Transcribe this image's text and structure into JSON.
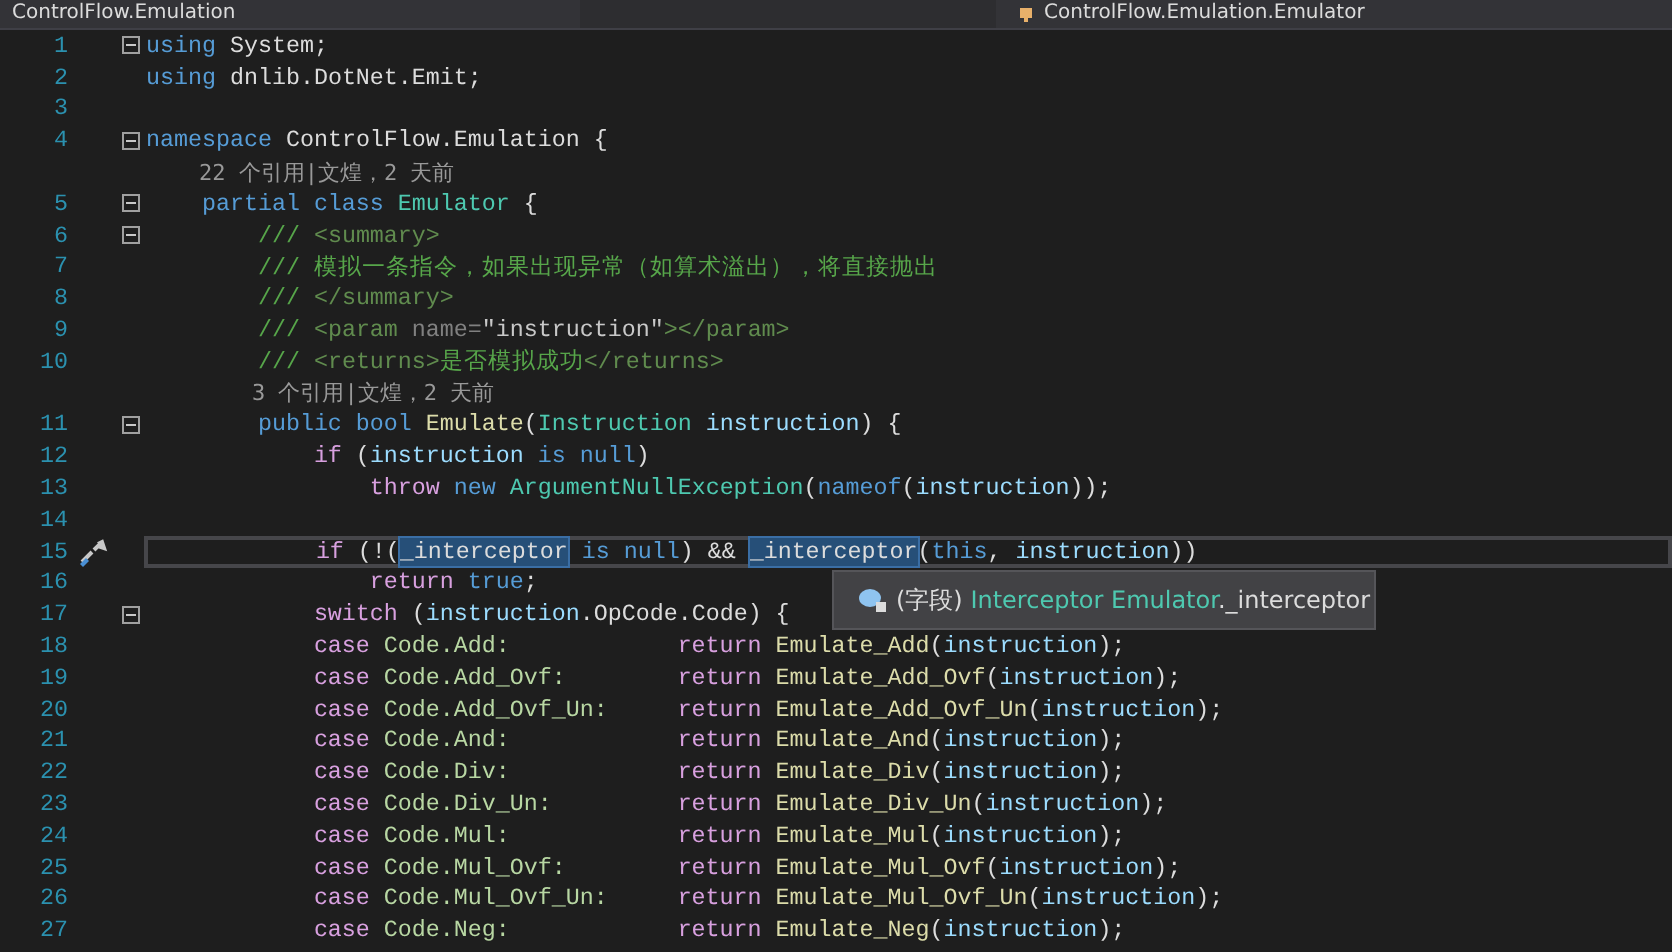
{
  "navigation_bar": {
    "project": "ControlFlow.Emulation",
    "member": "ControlFlow.Emulation.Emulator"
  },
  "lines": [
    {
      "number": "1",
      "fold": true,
      "tokens": [
        {
          "kind": "keyword",
          "text": "using"
        },
        {
          "kind": "plain",
          "text": " System;"
        }
      ]
    },
    {
      "number": "2",
      "tokens": [
        {
          "kind": "keyword",
          "text": "using"
        },
        {
          "kind": "plain",
          "text": " dnlib.DotNet.Emit;"
        }
      ]
    },
    {
      "number": "3"
    },
    {
      "number": "4",
      "fold": true,
      "tokens": [
        {
          "kind": "keyword",
          "text": "namespace"
        },
        {
          "kind": "plain",
          "text": " ControlFlow.Emulation {"
        }
      ]
    },
    {
      "tokens": [
        {
          "kind": "lens",
          "text": "    22 个引用|文煌，2 天前"
        }
      ]
    },
    {
      "number": "5",
      "fold": true,
      "tokens": [
        {
          "kind": "keyword",
          "text": "    partial class "
        },
        {
          "kind": "type",
          "text": "Emulator"
        },
        {
          "kind": "plain",
          "text": " {"
        }
      ]
    },
    {
      "number": "6",
      "fold": true,
      "tokens": [
        {
          "kind": "comment",
          "text": "        /// "
        },
        {
          "kind": "doctag",
          "text": "<summary>"
        }
      ]
    },
    {
      "number": "7",
      "tokens": [
        {
          "kind": "comment",
          "text": "        /// 模拟一条指令，如果出现异常（如算术溢出），将直接抛出"
        }
      ]
    },
    {
      "number": "8",
      "tokens": [
        {
          "kind": "comment",
          "text": "        /// "
        },
        {
          "kind": "doctag",
          "text": "</summary>"
        }
      ]
    },
    {
      "number": "9",
      "tokens": [
        {
          "kind": "comment",
          "text": "        /// "
        },
        {
          "kind": "doctag",
          "text": "<param "
        },
        {
          "kind": "docattr",
          "text": "name="
        },
        {
          "kind": "docvalue",
          "text": "\"instruction\""
        },
        {
          "kind": "doctag",
          "text": "></param>"
        }
      ]
    },
    {
      "number": "10",
      "tokens": [
        {
          "kind": "comment",
          "text": "        /// "
        },
        {
          "kind": "doctag",
          "text": "<returns>"
        },
        {
          "kind": "comment",
          "text": "是否模拟成功"
        },
        {
          "kind": "doctag",
          "text": "</returns>"
        }
      ]
    },
    {
      "tokens": [
        {
          "kind": "lens",
          "text": "        3 个引用|文煌，2 天前"
        }
      ]
    },
    {
      "number": "11",
      "fold": true,
      "tokens": [
        {
          "kind": "keyword",
          "text": "        public bool "
        },
        {
          "kind": "method",
          "text": "Emulate"
        },
        {
          "kind": "plain",
          "text": "("
        },
        {
          "kind": "type",
          "text": "Instruction "
        },
        {
          "kind": "variable",
          "text": "instruction"
        },
        {
          "kind": "plain",
          "text": ") {"
        }
      ]
    },
    {
      "number": "12",
      "tokens": [
        {
          "kind": "control",
          "text": "            if"
        },
        {
          "kind": "plain",
          "text": " ("
        },
        {
          "kind": "variable",
          "text": "instruction"
        },
        {
          "kind": "keyword",
          "text": " is null"
        },
        {
          "kind": "plain",
          "text": ")"
        }
      ]
    },
    {
      "number": "13",
      "tokens": [
        {
          "kind": "control",
          "text": "                throw"
        },
        {
          "kind": "keyword",
          "text": " new "
        },
        {
          "kind": "type",
          "text": "ArgumentNullException"
        },
        {
          "kind": "plain",
          "text": "("
        },
        {
          "kind": "keyword",
          "text": "nameof"
        },
        {
          "kind": "plain",
          "text": "("
        },
        {
          "kind": "variable",
          "text": "instruction"
        },
        {
          "kind": "plain",
          "text": "));"
        }
      ]
    },
    {
      "number": "14"
    },
    {
      "number": "15",
      "current": true,
      "quick_actions": true,
      "tokens": [
        {
          "kind": "control",
          "text": "            if",
          "highlighted": false
        },
        {
          "kind": "plain",
          "text": " (!(",
          "highlighted": false
        },
        {
          "kind": "field",
          "text": "_interceptor",
          "highlighted": true
        },
        {
          "kind": "keyword",
          "text": " is null",
          "highlighted": false
        },
        {
          "kind": "plain",
          "text": ") && ",
          "highlighted": false
        },
        {
          "kind": "field",
          "text": "_interceptor",
          "highlighted": true
        },
        {
          "kind": "plain",
          "text": "(",
          "highlighted": false
        },
        {
          "kind": "keyword",
          "text": "this",
          "highlighted": false
        },
        {
          "kind": "plain",
          "text": ", ",
          "highlighted": false
        },
        {
          "kind": "variable",
          "text": "instruction",
          "highlighted": false
        },
        {
          "kind": "plain",
          "text": "))",
          "highlighted": false
        }
      ]
    },
    {
      "number": "16",
      "tokens": [
        {
          "kind": "control",
          "text": "                return"
        },
        {
          "kind": "keyword",
          "text": " true"
        },
        {
          "kind": "plain",
          "text": ";"
        }
      ]
    },
    {
      "number": "17",
      "fold": true,
      "tokens": [
        {
          "kind": "control",
          "text": "            switch"
        },
        {
          "kind": "plain",
          "text": " ("
        },
        {
          "kind": "variable",
          "text": "instruction"
        },
        {
          "kind": "plain",
          "text": ".OpCode.Code) {"
        }
      ]
    },
    {
      "number": "18",
      "tokens": [
        {
          "kind": "control",
          "text": "            case"
        },
        {
          "kind": "enum",
          "text": " Code.Add:            "
        },
        {
          "kind": "control",
          "text": "return "
        },
        {
          "kind": "method",
          "text": "Emulate_Add"
        },
        {
          "kind": "plain",
          "text": "("
        },
        {
          "kind": "variable",
          "text": "instruction"
        },
        {
          "kind": "plain",
          "text": ");"
        }
      ]
    },
    {
      "number": "19",
      "tokens": [
        {
          "kind": "control",
          "text": "            case"
        },
        {
          "kind": "enum",
          "text": " Code.Add_Ovf:        "
        },
        {
          "kind": "control",
          "text": "return "
        },
        {
          "kind": "method",
          "text": "Emulate_Add_Ovf"
        },
        {
          "kind": "plain",
          "text": "("
        },
        {
          "kind": "variable",
          "text": "instruction"
        },
        {
          "kind": "plain",
          "text": ");"
        }
      ]
    },
    {
      "number": "20",
      "tokens": [
        {
          "kind": "control",
          "text": "            case"
        },
        {
          "kind": "enum",
          "text": " Code.Add_Ovf_Un:     "
        },
        {
          "kind": "control",
          "text": "return "
        },
        {
          "kind": "method",
          "text": "Emulate_Add_Ovf_Un"
        },
        {
          "kind": "plain",
          "text": "("
        },
        {
          "kind": "variable",
          "text": "instruction"
        },
        {
          "kind": "plain",
          "text": ");"
        }
      ]
    },
    {
      "number": "21",
      "tokens": [
        {
          "kind": "control",
          "text": "            case"
        },
        {
          "kind": "enum",
          "text": " Code.And:            "
        },
        {
          "kind": "control",
          "text": "return "
        },
        {
          "kind": "method",
          "text": "Emulate_And"
        },
        {
          "kind": "plain",
          "text": "("
        },
        {
          "kind": "variable",
          "text": "instruction"
        },
        {
          "kind": "plain",
          "text": ");"
        }
      ]
    },
    {
      "number": "22",
      "tokens": [
        {
          "kind": "control",
          "text": "            case"
        },
        {
          "kind": "enum",
          "text": " Code.Div:            "
        },
        {
          "kind": "control",
          "text": "return "
        },
        {
          "kind": "method",
          "text": "Emulate_Div"
        },
        {
          "kind": "plain",
          "text": "("
        },
        {
          "kind": "variable",
          "text": "instruction"
        },
        {
          "kind": "plain",
          "text": ");"
        }
      ]
    },
    {
      "number": "23",
      "tokens": [
        {
          "kind": "control",
          "text": "            case"
        },
        {
          "kind": "enum",
          "text": " Code.Div_Un:         "
        },
        {
          "kind": "control",
          "text": "return "
        },
        {
          "kind": "method",
          "text": "Emulate_Div_Un"
        },
        {
          "kind": "plain",
          "text": "("
        },
        {
          "kind": "variable",
          "text": "instruction"
        },
        {
          "kind": "plain",
          "text": ");"
        }
      ]
    },
    {
      "number": "24",
      "tokens": [
        {
          "kind": "control",
          "text": "            case"
        },
        {
          "kind": "enum",
          "text": " Code.Mul:            "
        },
        {
          "kind": "control",
          "text": "return "
        },
        {
          "kind": "method",
          "text": "Emulate_Mul"
        },
        {
          "kind": "plain",
          "text": "("
        },
        {
          "kind": "variable",
          "text": "instruction"
        },
        {
          "kind": "plain",
          "text": ");"
        }
      ]
    },
    {
      "number": "25",
      "tokens": [
        {
          "kind": "control",
          "text": "            case"
        },
        {
          "kind": "enum",
          "text": " Code.Mul_Ovf:        "
        },
        {
          "kind": "control",
          "text": "return "
        },
        {
          "kind": "method",
          "text": "Emulate_Mul_Ovf"
        },
        {
          "kind": "plain",
          "text": "("
        },
        {
          "kind": "variable",
          "text": "instruction"
        },
        {
          "kind": "plain",
          "text": ");"
        }
      ]
    },
    {
      "number": "26",
      "tokens": [
        {
          "kind": "control",
          "text": "            case"
        },
        {
          "kind": "enum",
          "text": " Code.Mul_Ovf_Un:     "
        },
        {
          "kind": "control",
          "text": "return "
        },
        {
          "kind": "method",
          "text": "Emulate_Mul_Ovf_Un"
        },
        {
          "kind": "plain",
          "text": "("
        },
        {
          "kind": "variable",
          "text": "instruction"
        },
        {
          "kind": "plain",
          "text": ");"
        }
      ]
    },
    {
      "number": "27",
      "tokens": [
        {
          "kind": "control",
          "text": "            case"
        },
        {
          "kind": "enum",
          "text": " Code.Neg:            "
        },
        {
          "kind": "control",
          "text": "return "
        },
        {
          "kind": "method",
          "text": "Emulate_Neg"
        },
        {
          "kind": "plain",
          "text": "("
        },
        {
          "kind": "variable",
          "text": "instruction"
        },
        {
          "kind": "plain",
          "text": ");"
        }
      ]
    }
  ],
  "tooltip": {
    "category": "(字段)",
    "type": "Interceptor Emulator",
    "member": "._interceptor"
  }
}
